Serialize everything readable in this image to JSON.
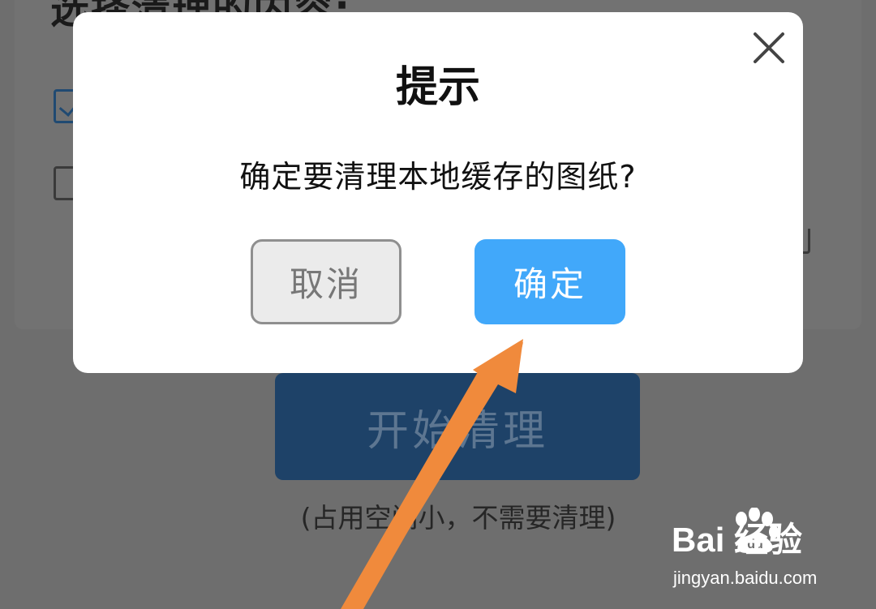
{
  "background": {
    "heading": "选择清理的内容:",
    "start_button_label": "开始清理",
    "note": "(占用空间小，不需要清理)"
  },
  "dialog": {
    "title": "提示",
    "message": "确定要清理本地缓存的图纸?",
    "cancel_label": "取消",
    "confirm_label": "确定",
    "close_icon": "close-icon"
  },
  "watermark": {
    "brand": "Bai  经验",
    "url": "jingyan.baidu.com"
  },
  "colors": {
    "confirm": "#41a8fa",
    "annotation_arrow": "#f08a3c",
    "start_button": "#1e4268"
  }
}
